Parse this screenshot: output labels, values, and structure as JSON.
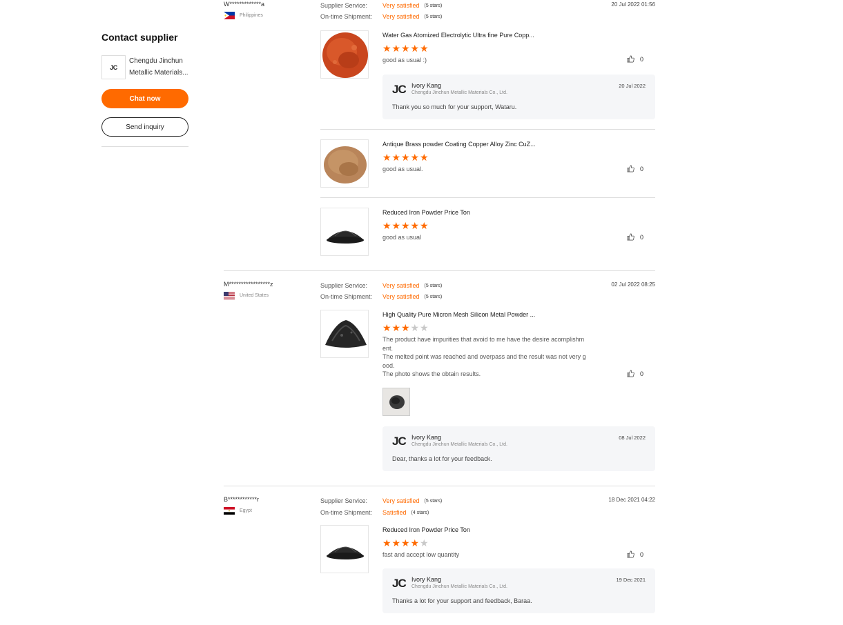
{
  "contact": {
    "heading": "Contact supplier",
    "supplier_name": "Chengdu Jinchun Metallic Materials...",
    "logo_text": "JC",
    "chat_label": "Chat now",
    "inquiry_label": "Send inquiry"
  },
  "rating_labels": {
    "service": "Supplier Service:",
    "shipment": "On-time Shipment:"
  },
  "accent_color": "#ff6a00",
  "reviews": [
    {
      "buyer": "W*************a",
      "country": "Philippines",
      "service_value": "Very satisfied",
      "service_stars": "(5 stars)",
      "shipment_value": "Very satisfied",
      "shipment_stars": "(5 stars)",
      "date": "20 Jul 2022 01:56",
      "products": [
        {
          "title": "Water Gas Atomized Electrolytic Ultra fine Pure Copp...",
          "rating": 5,
          "comment": "good as usual :)",
          "likes": "0",
          "image": "copper-powder",
          "reply": {
            "logo": "JC",
            "name": "Ivory Kang",
            "company": "Chengdu Jinchun Metallic Materials Co., Ltd.",
            "date": "20 Jul 2022",
            "text": "Thank you so much for your support, Wataru."
          }
        },
        {
          "title": "Antique Brass powder Coating Copper Alloy Zinc CuZ...",
          "rating": 5,
          "comment": "good as usual.",
          "likes": "0",
          "image": "brass-powder"
        },
        {
          "title": "Reduced Iron Powder Price Ton",
          "rating": 5,
          "comment": "good as usual",
          "likes": "0",
          "image": "iron-powder"
        }
      ]
    },
    {
      "buyer": "M*****************z",
      "country": "United States",
      "service_value": "Very satisfied",
      "service_stars": "(5 stars)",
      "shipment_value": "Very satisfied",
      "shipment_stars": "(5 stars)",
      "date": "02 Jul 2022 08:25",
      "products": [
        {
          "title": "High Quality Pure Micron Mesh Silicon Metal Powder ...",
          "rating": 3,
          "comment_lines": [
            "The product have impurities that avoid to me have the desire acomplishm",
            "ent.",
            "The melted point was reached and overpass and the result was not very g",
            "ood.",
            "The photo shows the obtain results."
          ],
          "likes": "0",
          "image": "silicon-powder",
          "reply": {
            "logo": "JC",
            "name": "Ivory Kang",
            "company": "Chengdu Jinchun Metallic Materials Co., Ltd.",
            "date": "08 Jul 2022",
            "text": "Dear, thanks a lot for your feedback."
          }
        }
      ]
    },
    {
      "buyer": "B************r",
      "country": "Egypt",
      "service_value": "Very satisfied",
      "service_stars": "(5 stars)",
      "shipment_value": "Satisfied",
      "shipment_stars": "(4 stars)",
      "date": "18 Dec 2021 04:22",
      "products": [
        {
          "title": "Reduced Iron Powder Price Ton",
          "rating": 4,
          "comment": "fast and accept low quantity",
          "likes": "0",
          "image": "iron-powder",
          "reply": {
            "logo": "JC",
            "name": "Ivory Kang",
            "company": "Chengdu Jinchun Metallic Materials Co., Ltd.",
            "date": "19 Dec 2021",
            "text": "Thanks a lot for your support and feedback, Baraa."
          }
        }
      ]
    }
  ]
}
